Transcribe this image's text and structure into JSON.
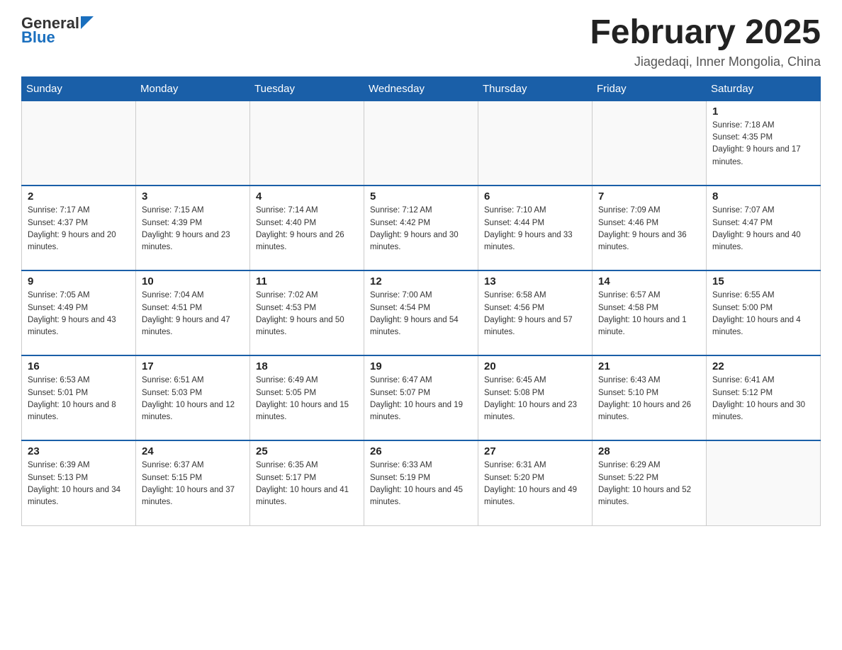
{
  "logo": {
    "general": "General",
    "blue": "Blue"
  },
  "title": "February 2025",
  "location": "Jiagedaqi, Inner Mongolia, China",
  "days_of_week": [
    "Sunday",
    "Monday",
    "Tuesday",
    "Wednesday",
    "Thursday",
    "Friday",
    "Saturday"
  ],
  "weeks": [
    [
      {
        "day": "",
        "info": ""
      },
      {
        "day": "",
        "info": ""
      },
      {
        "day": "",
        "info": ""
      },
      {
        "day": "",
        "info": ""
      },
      {
        "day": "",
        "info": ""
      },
      {
        "day": "",
        "info": ""
      },
      {
        "day": "1",
        "info": "Sunrise: 7:18 AM\nSunset: 4:35 PM\nDaylight: 9 hours and 17 minutes."
      }
    ],
    [
      {
        "day": "2",
        "info": "Sunrise: 7:17 AM\nSunset: 4:37 PM\nDaylight: 9 hours and 20 minutes."
      },
      {
        "day": "3",
        "info": "Sunrise: 7:15 AM\nSunset: 4:39 PM\nDaylight: 9 hours and 23 minutes."
      },
      {
        "day": "4",
        "info": "Sunrise: 7:14 AM\nSunset: 4:40 PM\nDaylight: 9 hours and 26 minutes."
      },
      {
        "day": "5",
        "info": "Sunrise: 7:12 AM\nSunset: 4:42 PM\nDaylight: 9 hours and 30 minutes."
      },
      {
        "day": "6",
        "info": "Sunrise: 7:10 AM\nSunset: 4:44 PM\nDaylight: 9 hours and 33 minutes."
      },
      {
        "day": "7",
        "info": "Sunrise: 7:09 AM\nSunset: 4:46 PM\nDaylight: 9 hours and 36 minutes."
      },
      {
        "day": "8",
        "info": "Sunrise: 7:07 AM\nSunset: 4:47 PM\nDaylight: 9 hours and 40 minutes."
      }
    ],
    [
      {
        "day": "9",
        "info": "Sunrise: 7:05 AM\nSunset: 4:49 PM\nDaylight: 9 hours and 43 minutes."
      },
      {
        "day": "10",
        "info": "Sunrise: 7:04 AM\nSunset: 4:51 PM\nDaylight: 9 hours and 47 minutes."
      },
      {
        "day": "11",
        "info": "Sunrise: 7:02 AM\nSunset: 4:53 PM\nDaylight: 9 hours and 50 minutes."
      },
      {
        "day": "12",
        "info": "Sunrise: 7:00 AM\nSunset: 4:54 PM\nDaylight: 9 hours and 54 minutes."
      },
      {
        "day": "13",
        "info": "Sunrise: 6:58 AM\nSunset: 4:56 PM\nDaylight: 9 hours and 57 minutes."
      },
      {
        "day": "14",
        "info": "Sunrise: 6:57 AM\nSunset: 4:58 PM\nDaylight: 10 hours and 1 minute."
      },
      {
        "day": "15",
        "info": "Sunrise: 6:55 AM\nSunset: 5:00 PM\nDaylight: 10 hours and 4 minutes."
      }
    ],
    [
      {
        "day": "16",
        "info": "Sunrise: 6:53 AM\nSunset: 5:01 PM\nDaylight: 10 hours and 8 minutes."
      },
      {
        "day": "17",
        "info": "Sunrise: 6:51 AM\nSunset: 5:03 PM\nDaylight: 10 hours and 12 minutes."
      },
      {
        "day": "18",
        "info": "Sunrise: 6:49 AM\nSunset: 5:05 PM\nDaylight: 10 hours and 15 minutes."
      },
      {
        "day": "19",
        "info": "Sunrise: 6:47 AM\nSunset: 5:07 PM\nDaylight: 10 hours and 19 minutes."
      },
      {
        "day": "20",
        "info": "Sunrise: 6:45 AM\nSunset: 5:08 PM\nDaylight: 10 hours and 23 minutes."
      },
      {
        "day": "21",
        "info": "Sunrise: 6:43 AM\nSunset: 5:10 PM\nDaylight: 10 hours and 26 minutes."
      },
      {
        "day": "22",
        "info": "Sunrise: 6:41 AM\nSunset: 5:12 PM\nDaylight: 10 hours and 30 minutes."
      }
    ],
    [
      {
        "day": "23",
        "info": "Sunrise: 6:39 AM\nSunset: 5:13 PM\nDaylight: 10 hours and 34 minutes."
      },
      {
        "day": "24",
        "info": "Sunrise: 6:37 AM\nSunset: 5:15 PM\nDaylight: 10 hours and 37 minutes."
      },
      {
        "day": "25",
        "info": "Sunrise: 6:35 AM\nSunset: 5:17 PM\nDaylight: 10 hours and 41 minutes."
      },
      {
        "day": "26",
        "info": "Sunrise: 6:33 AM\nSunset: 5:19 PM\nDaylight: 10 hours and 45 minutes."
      },
      {
        "day": "27",
        "info": "Sunrise: 6:31 AM\nSunset: 5:20 PM\nDaylight: 10 hours and 49 minutes."
      },
      {
        "day": "28",
        "info": "Sunrise: 6:29 AM\nSunset: 5:22 PM\nDaylight: 10 hours and 52 minutes."
      },
      {
        "day": "",
        "info": ""
      }
    ]
  ]
}
